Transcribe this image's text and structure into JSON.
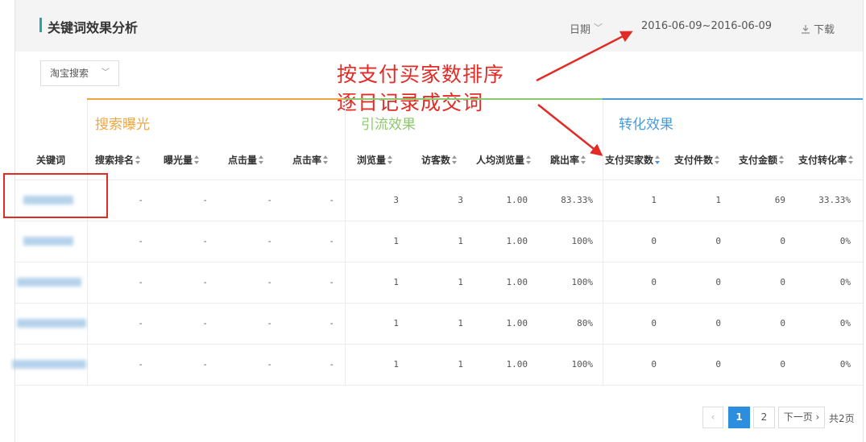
{
  "header": {
    "title": "关键词效果分析",
    "date_label": "日期",
    "date_range": "2016-06-09~2016-06-09",
    "download": "下载"
  },
  "filter": {
    "source": "淘宝搜索"
  },
  "annotation": {
    "line1": "按支付买家数排序",
    "line2": "逐日记录成交词"
  },
  "groups": {
    "search": {
      "label": "搜索曝光",
      "color": "#f0a640"
    },
    "traffic": {
      "label": "引流效果",
      "color": "#8cc86d"
    },
    "conversion": {
      "label": "转化效果",
      "color": "#4a9bd6"
    }
  },
  "columns": {
    "keyword": "关键词",
    "rank": "搜索排名",
    "impressions": "曝光量",
    "clicks": "点击量",
    "ctr": "点击率",
    "pv": "浏览量",
    "visitors": "访客数",
    "pv_per": "人均浏览量",
    "bounce": "跳出率",
    "buyers": "支付买家数",
    "items": "支付件数",
    "amount": "支付金额",
    "cvr": "支付转化率"
  },
  "rows": [
    {
      "rank": "-",
      "impressions": "-",
      "clicks": "-",
      "ctr": "-",
      "pv": "3",
      "visitors": "3",
      "pv_per": "1.00",
      "bounce": "83.33%",
      "buyers": "1",
      "items": "1",
      "amount": "69",
      "cvr": "33.33%"
    },
    {
      "rank": "-",
      "impressions": "-",
      "clicks": "-",
      "ctr": "-",
      "pv": "1",
      "visitors": "1",
      "pv_per": "1.00",
      "bounce": "100%",
      "buyers": "0",
      "items": "0",
      "amount": "0",
      "cvr": "0%"
    },
    {
      "rank": "-",
      "impressions": "-",
      "clicks": "-",
      "ctr": "-",
      "pv": "1",
      "visitors": "1",
      "pv_per": "1.00",
      "bounce": "100%",
      "buyers": "0",
      "items": "0",
      "amount": "0",
      "cvr": "0%"
    },
    {
      "rank": "-",
      "impressions": "-",
      "clicks": "-",
      "ctr": "-",
      "pv": "1",
      "visitors": "1",
      "pv_per": "1.00",
      "bounce": "80%",
      "buyers": "0",
      "items": "0",
      "amount": "0",
      "cvr": "0%"
    },
    {
      "rank": "-",
      "impressions": "-",
      "clicks": "-",
      "ctr": "-",
      "pv": "1",
      "visitors": "1",
      "pv_per": "1.00",
      "bounce": "100%",
      "buyers": "0",
      "items": "0",
      "amount": "0",
      "cvr": "0%"
    }
  ],
  "pagination": {
    "prev": "‹",
    "pages": [
      "1",
      "2"
    ],
    "current": "1",
    "next": "下一页 ›",
    "total": "共2页"
  },
  "colors": {
    "accent": "#25a7a0",
    "annotation": "#e32b25",
    "page_active": "#2d8ee0"
  }
}
